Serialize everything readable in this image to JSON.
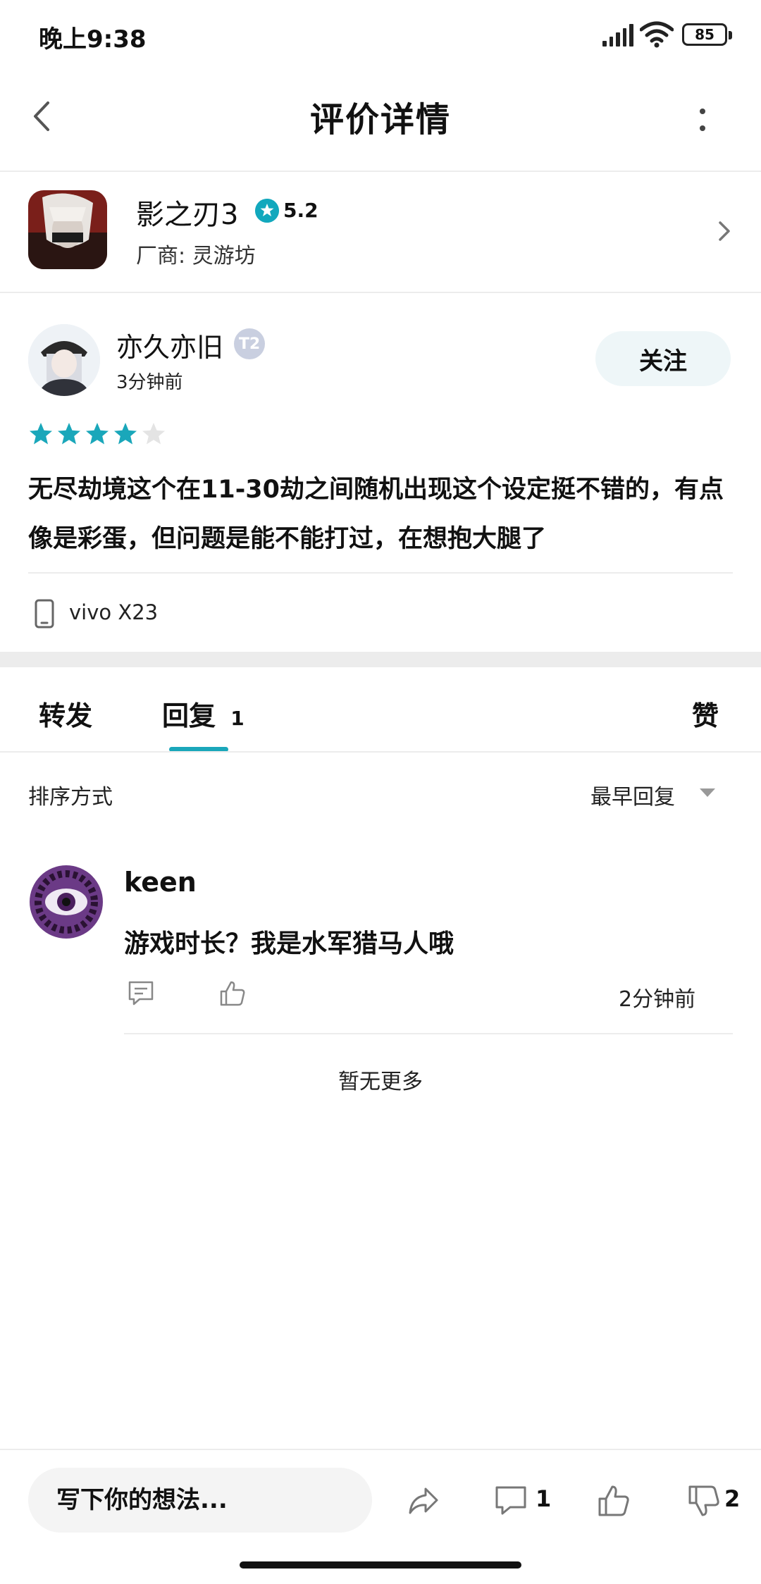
{
  "status_bar": {
    "time": "晚上9:38",
    "battery": "85"
  },
  "header": {
    "title": "评价详情"
  },
  "game": {
    "name": "影之刃3",
    "rating": "5.2",
    "vendor": "厂商: 灵游坊"
  },
  "review": {
    "username": "亦久亦旧",
    "badge": "T2",
    "time": "3分钟前",
    "follow_label": "关注",
    "stars": 4,
    "stars_max": 5,
    "text": "无尽劫境这个在11-30劫之间随机出现这个设定挺不错的，有点像是彩蛋，但问题是能不能打过，在想抱大腿了",
    "device": "vivo X23"
  },
  "tabs": {
    "forward": "转发",
    "reply": "回复",
    "reply_count": "1",
    "like": "赞"
  },
  "sort": {
    "label": "排序方式",
    "value": "最早回复"
  },
  "replies": [
    {
      "name": "keen",
      "text": "游戏时长？我是水军猎马人哦",
      "time": "2分钟前"
    }
  ],
  "no_more": "暂无更多",
  "bottom_bar": {
    "placeholder": "写下你的想法...",
    "comment_count": "1",
    "dislike_count": "2"
  },
  "colors": {
    "accent": "#1aa7ba",
    "star_empty": "#e4e4e4"
  }
}
